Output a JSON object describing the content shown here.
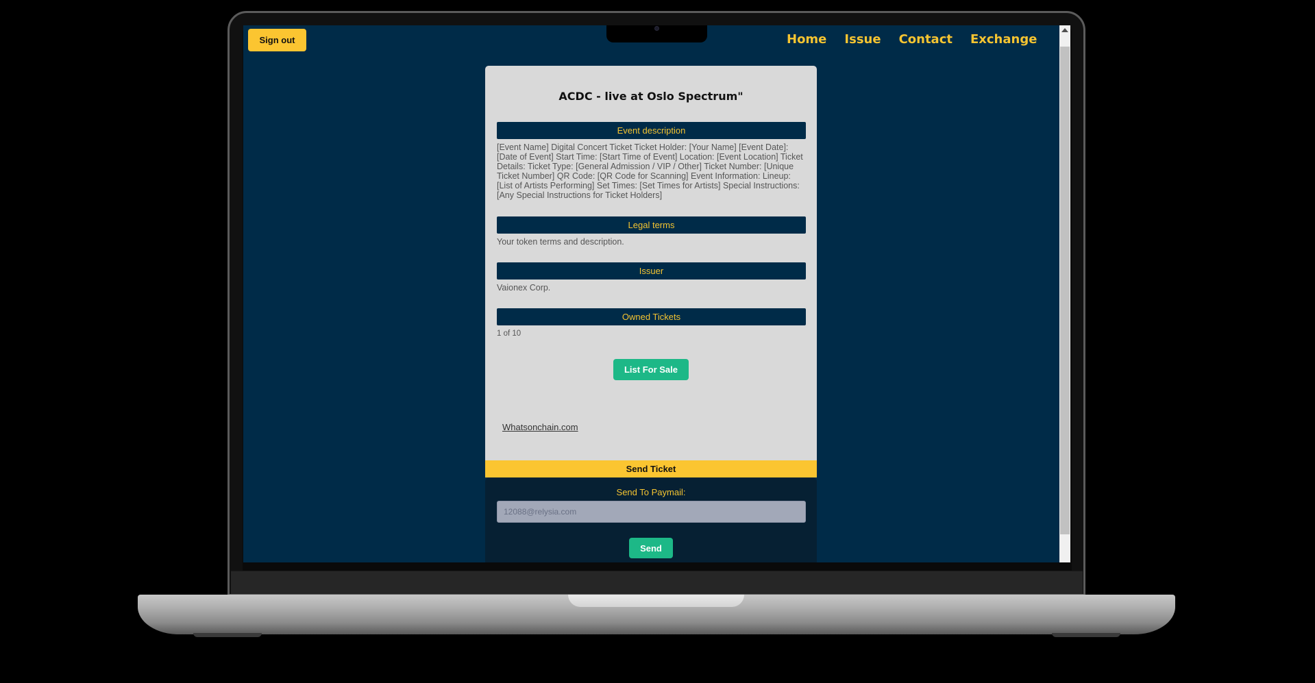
{
  "header": {
    "signout_label": "Sign out",
    "nav": [
      "Home",
      "Issue",
      "Contact",
      "Exchange"
    ]
  },
  "card": {
    "title": "ACDC - live at Oslo Spectrum\"",
    "sections": [
      {
        "heading": "Event description",
        "text": "[Event Name] Digital Concert Ticket Ticket Holder: [Your Name] [Event Date]: [Date of Event] Start Time: [Start Time of Event] Location: [Event Location] Ticket Details: Ticket Type: [General Admission / VIP / Other] Ticket Number: [Unique Ticket Number] QR Code: [QR Code for Scanning] Event Information: Lineup: [List of Artists Performing] Set Times: [Set Times for Artists] Special Instructions: [Any Special Instructions for Ticket Holders]"
      },
      {
        "heading": "Legal terms",
        "text": "Your token terms and description."
      },
      {
        "heading": "Issuer",
        "text": "Vaionex Corp."
      },
      {
        "heading": "Owned Tickets",
        "text": "1 of 10"
      }
    ],
    "list_for_sale_label": "List For Sale",
    "explorer_link": "Whatsonchain.com"
  },
  "send": {
    "heading": "Send Ticket",
    "label": "Send To Paymail:",
    "input_value": "12088@relysia.com",
    "button_label": "Send"
  },
  "colors": {
    "background": "#002b48",
    "accent_yellow": "#fbc531",
    "accent_green": "#1db887",
    "card": "#d9d9d9"
  }
}
